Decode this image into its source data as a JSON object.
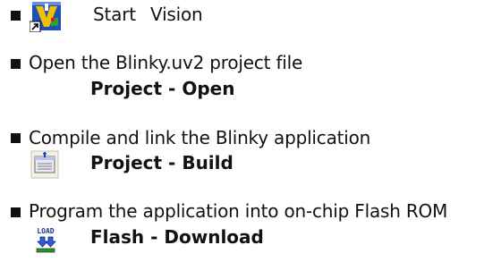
{
  "steps": [
    {
      "text_parts": [
        "Start",
        "Vision"
      ],
      "icon": "keil-uvision-icon"
    },
    {
      "text": "Open the Blinky.uv2 project file",
      "command": "Project - Open"
    },
    {
      "text": "Compile and link the Blinky application",
      "command": "Project - Build",
      "icon": "build-icon"
    },
    {
      "text": "Program the application into on-chip Flash ROM",
      "command": "Flash - Download",
      "icon": "load-icon",
      "icon_text": "LOAD"
    }
  ],
  "colors": {
    "text": "#111111",
    "bullet": "#111111"
  }
}
